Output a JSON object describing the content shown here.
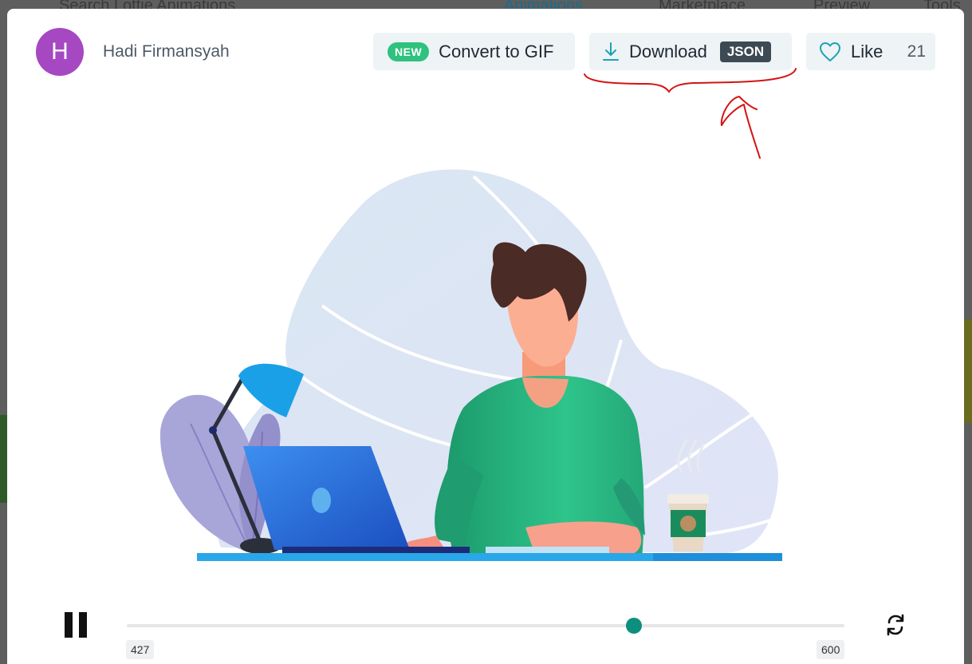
{
  "background": {
    "nav_items": [
      "Search Lottie Animations",
      "Animations",
      "Marketplace",
      "Preview",
      "Tools"
    ]
  },
  "header": {
    "avatar_letter": "H",
    "author_name": "Hadi Firmansyah",
    "convert_button": {
      "badge": "NEW",
      "label": "Convert to GIF"
    },
    "download_button": {
      "label": "Download",
      "badge": "JSON"
    },
    "like_button": {
      "label": "Like",
      "count": "21"
    }
  },
  "player": {
    "current_frame": "427",
    "total_frames": "600",
    "progress": 0.707
  },
  "colors": {
    "accent": "#0d8f7e",
    "new_badge": "#2ec27e",
    "avatar": "#a548c2",
    "annotation": "#d41414"
  }
}
